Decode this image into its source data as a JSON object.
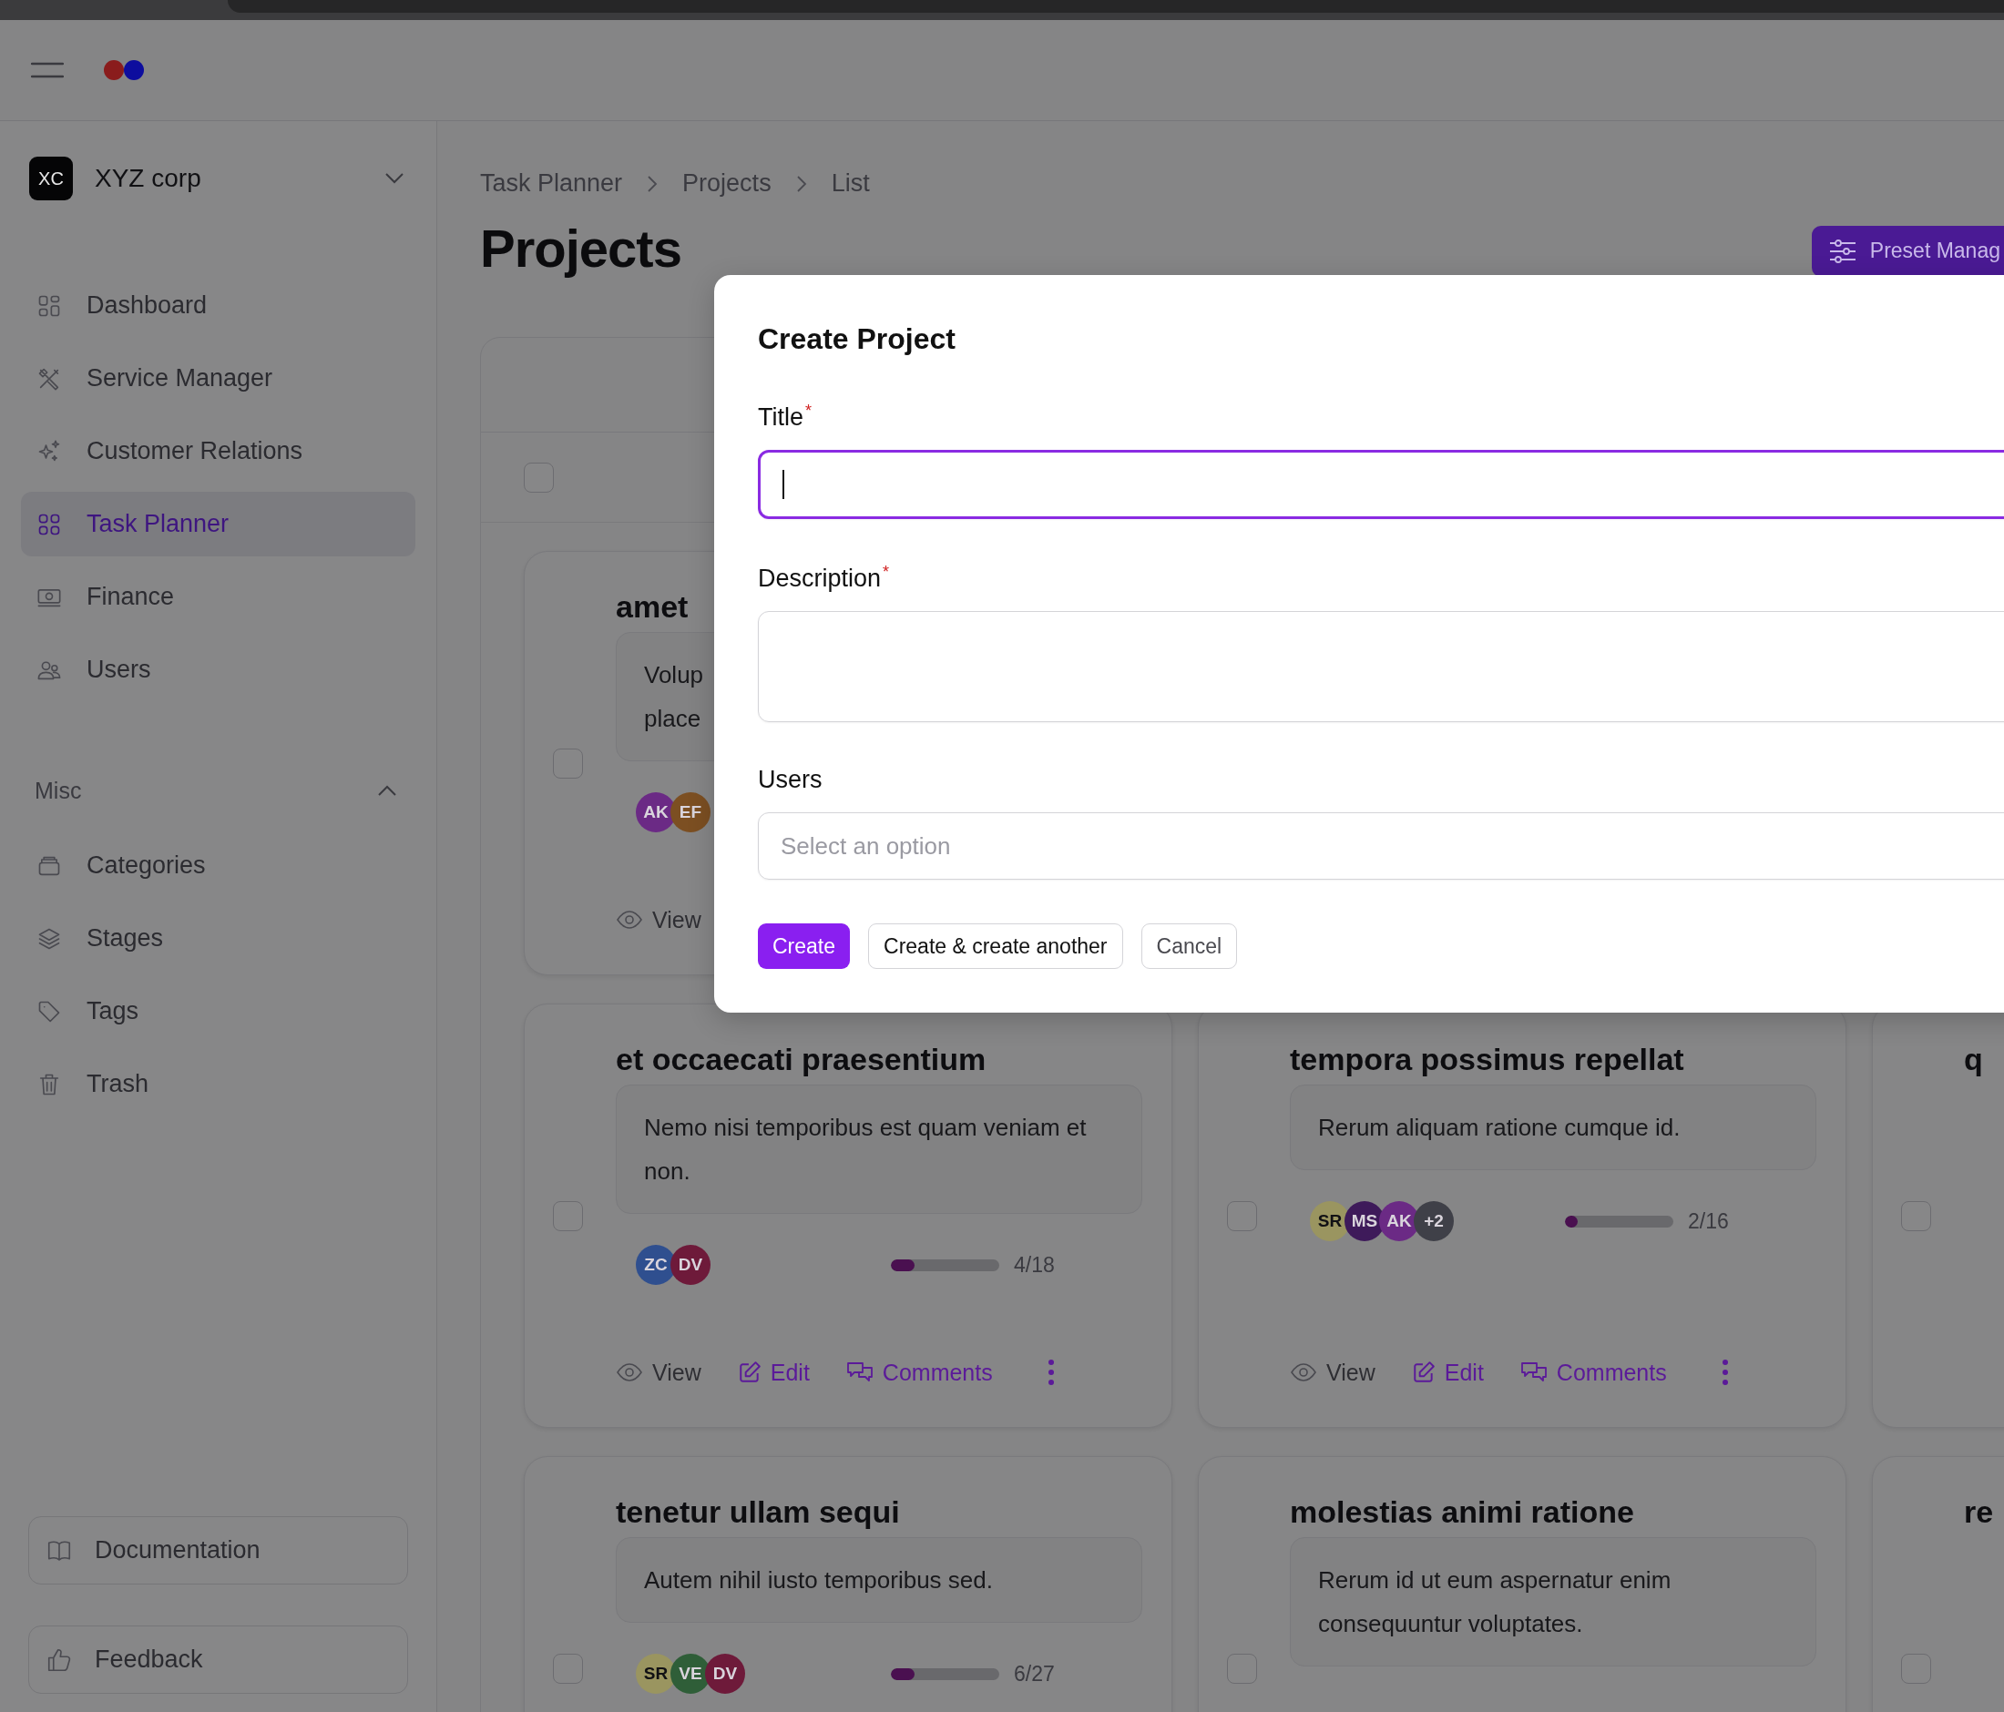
{
  "sidebar": {
    "org": {
      "initials": "XC",
      "name": "XYZ corp"
    },
    "items": [
      {
        "label": "Dashboard",
        "selected": false
      },
      {
        "label": "Service Manager",
        "selected": false
      },
      {
        "label": "Customer Relations",
        "selected": false
      },
      {
        "label": "Task Planner",
        "selected": true
      },
      {
        "label": "Finance",
        "selected": false
      },
      {
        "label": "Users",
        "selected": false
      }
    ],
    "misc": {
      "label": "Misc",
      "expanded": true,
      "items": [
        {
          "label": "Categories",
          "selected": false
        },
        {
          "label": "Stages",
          "selected": false
        },
        {
          "label": "Tags",
          "selected": false
        },
        {
          "label": "Trash",
          "selected": false
        }
      ]
    },
    "footer_buttons": [
      "Documentation",
      "Feedback"
    ]
  },
  "breadcrumbs": [
    "Task Planner",
    "Projects",
    "List"
  ],
  "page_title": "Projects",
  "preset_button": "Preset Manag",
  "select_all": {
    "checked": false
  },
  "cards": [
    {
      "title": "amet",
      "description": "Volup\nplace",
      "checked": false,
      "avatars": [
        {
          "initials": "AK",
          "color": "#6b2a85"
        },
        {
          "initials": "EF",
          "color": "#7c4f22"
        }
      ],
      "actions": [
        "View"
      ]
    },
    {
      "title": "et occaecati praesentium",
      "description": "Nemo nisi temporibus est quam veniam et non.",
      "checked": false,
      "avatars": [
        {
          "initials": "ZC",
          "color": "#2f4f8f"
        },
        {
          "initials": "DV",
          "color": "#6e1a3a"
        }
      ],
      "progress": {
        "level": 0.22,
        "count": "4/18"
      },
      "actions": [
        "View",
        "Edit",
        "Comments"
      ]
    },
    {
      "title": "tempora possimus repellat",
      "description": "Rerum aliquam ratione cumque id.",
      "checked": false,
      "avatars": [
        {
          "initials": "SR",
          "color": "#9a9560"
        },
        {
          "initials": "MS",
          "color": "#3e1a5a"
        },
        {
          "initials": "AK",
          "color": "#6b2a85"
        },
        {
          "initials": "+2",
          "color": "#3f4048"
        }
      ],
      "progress": {
        "level": 0.12,
        "count": "2/16"
      },
      "actions": [
        "View",
        "Edit",
        "Comments"
      ]
    },
    {
      "title": "q",
      "checked": false
    },
    {
      "title": "tenetur ullam sequi",
      "description": "Autem nihil iusto temporibus sed.",
      "checked": false,
      "avatars": [
        {
          "initials": "SR",
          "color": "#9a9560"
        },
        {
          "initials": "VE",
          "color": "#2f5e38"
        },
        {
          "initials": "DV",
          "color": "#6e1a3a"
        }
      ],
      "progress": {
        "level": 0.22,
        "count": "6/27"
      }
    },
    {
      "title": "molestias animi ratione",
      "description": "Rerum id ut eum aspernatur enim consequuntur voluptates.",
      "checked": false
    },
    {
      "title": "re",
      "checked": false
    }
  ],
  "dialog": {
    "title": "Create Project",
    "fields": [
      {
        "kind": "input",
        "label": "Title",
        "required_mark": "*",
        "focused": true
      },
      {
        "kind": "textarea",
        "label": "Description",
        "required_mark": "*",
        "focused": false
      },
      {
        "kind": "select",
        "label": "Users",
        "placeholder": "Select an option",
        "focused": false
      }
    ],
    "buttons": [
      {
        "kind": "primary",
        "label": "Create"
      },
      {
        "kind": "secondary",
        "label": "Create & create another"
      },
      {
        "kind": "tertiary",
        "label": "Cancel"
      }
    ]
  }
}
